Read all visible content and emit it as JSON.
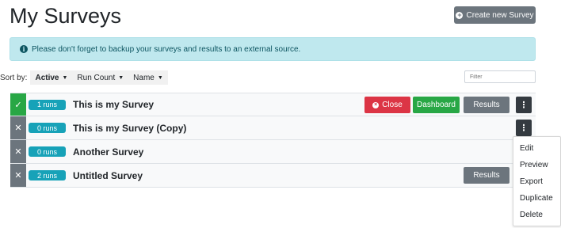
{
  "header": {
    "title": "My Surveys",
    "create_label": "Create new Survey"
  },
  "alert": {
    "text": "Please don't forget to backup your surveys and results to an external source."
  },
  "sort": {
    "label": "Sort by:",
    "options": [
      {
        "label": "Active",
        "active": true
      },
      {
        "label": "Run Count",
        "active": false
      },
      {
        "label": "Name",
        "active": false
      }
    ]
  },
  "filter": {
    "placeholder": "Filter"
  },
  "surveys": [
    {
      "name": "This is my Survey",
      "runs": "1 runs",
      "active": true,
      "actions": [
        "Close",
        "Dashboard",
        "Results"
      ]
    },
    {
      "name": "This is my Survey (Copy)",
      "runs": "0 runs",
      "active": false,
      "actions": []
    },
    {
      "name": "Another Survey",
      "runs": "0 runs",
      "active": false,
      "actions": []
    },
    {
      "name": "Untitled Survey",
      "runs": "2 runs",
      "active": false,
      "actions": [
        "Results"
      ]
    }
  ],
  "buttons": {
    "close": "Close",
    "dashboard": "Dashboard",
    "results": "Results"
  },
  "dropdown_menu": [
    "Edit",
    "Preview",
    "Export",
    "Duplicate",
    "Delete"
  ],
  "colors": {
    "active_green": "#28a745",
    "inactive_gray": "#6c757d",
    "runs_badge": "#17a2b8",
    "close_red": "#dc3545",
    "alert_bg": "#bfe8ee"
  }
}
